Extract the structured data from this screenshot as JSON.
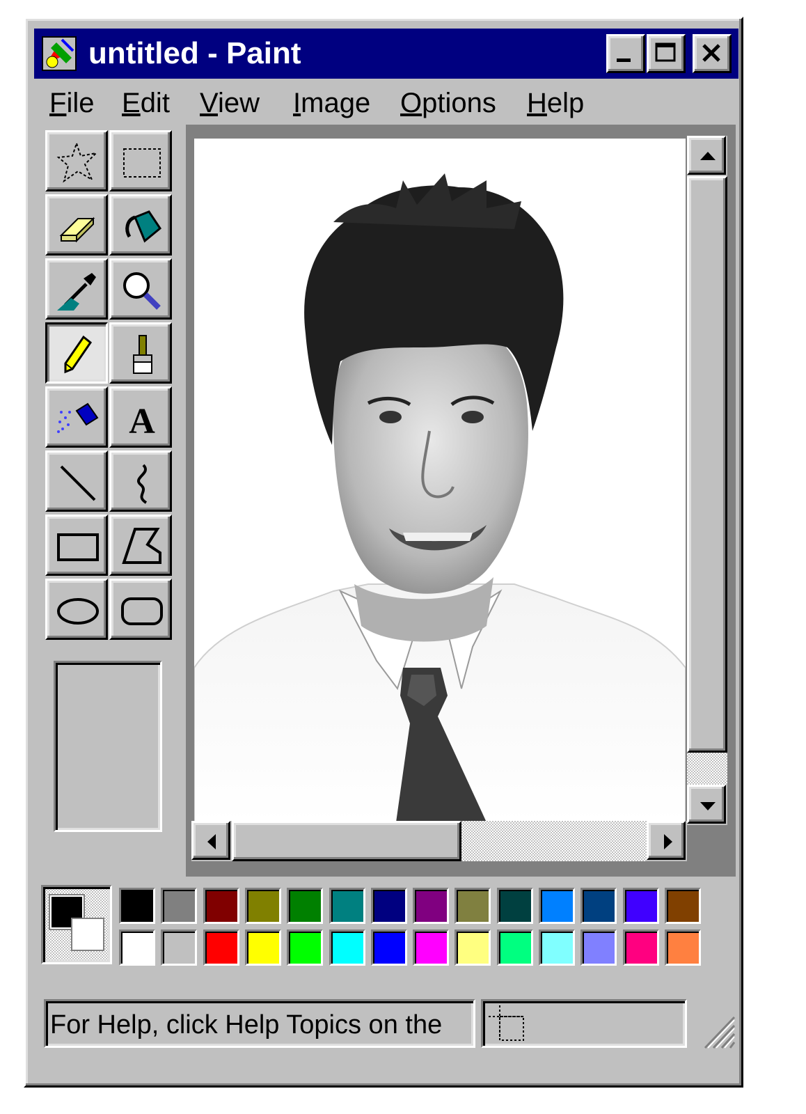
{
  "window": {
    "title": "untitled - Paint"
  },
  "menubar": {
    "items": [
      {
        "mnemonic": "F",
        "rest": "ile"
      },
      {
        "mnemonic": "E",
        "rest": "dit"
      },
      {
        "mnemonic": "V",
        "rest": "iew"
      },
      {
        "mnemonic": "I",
        "rest": "mage"
      },
      {
        "mnemonic": "O",
        "rest": "ptions"
      },
      {
        "mnemonic": "H",
        "rest": "elp"
      }
    ]
  },
  "toolbox": {
    "tools": [
      "free-form-select-icon",
      "rect-select-icon",
      "eraser-icon",
      "fill-icon",
      "color-picker-icon",
      "magnifier-icon",
      "pencil-icon",
      "brush-icon",
      "airbrush-icon",
      "text-icon",
      "line-icon",
      "curve-icon",
      "rectangle-icon",
      "polygon-icon",
      "ellipse-icon",
      "rounded-rectangle-icon"
    ],
    "active_tool": "pencil-icon",
    "text_tool_glyph": "A"
  },
  "colors": {
    "foreground": "#000000",
    "background": "#ffffff",
    "palette_top": [
      "#000000",
      "#808080",
      "#800000",
      "#808000",
      "#008000",
      "#008080",
      "#000080",
      "#800080",
      "#808040",
      "#004040",
      "#0080ff",
      "#004080",
      "#4000ff",
      "#804000"
    ],
    "palette_bottom": [
      "#ffffff",
      "#c0c0c0",
      "#ff0000",
      "#ffff00",
      "#00ff00",
      "#00ffff",
      "#0000ff",
      "#ff00ff",
      "#ffff80",
      "#00ff80",
      "#80ffff",
      "#8080ff",
      "#ff0080",
      "#ff8040"
    ]
  },
  "statusbar": {
    "text": "For Help, click Help Topics on the"
  }
}
